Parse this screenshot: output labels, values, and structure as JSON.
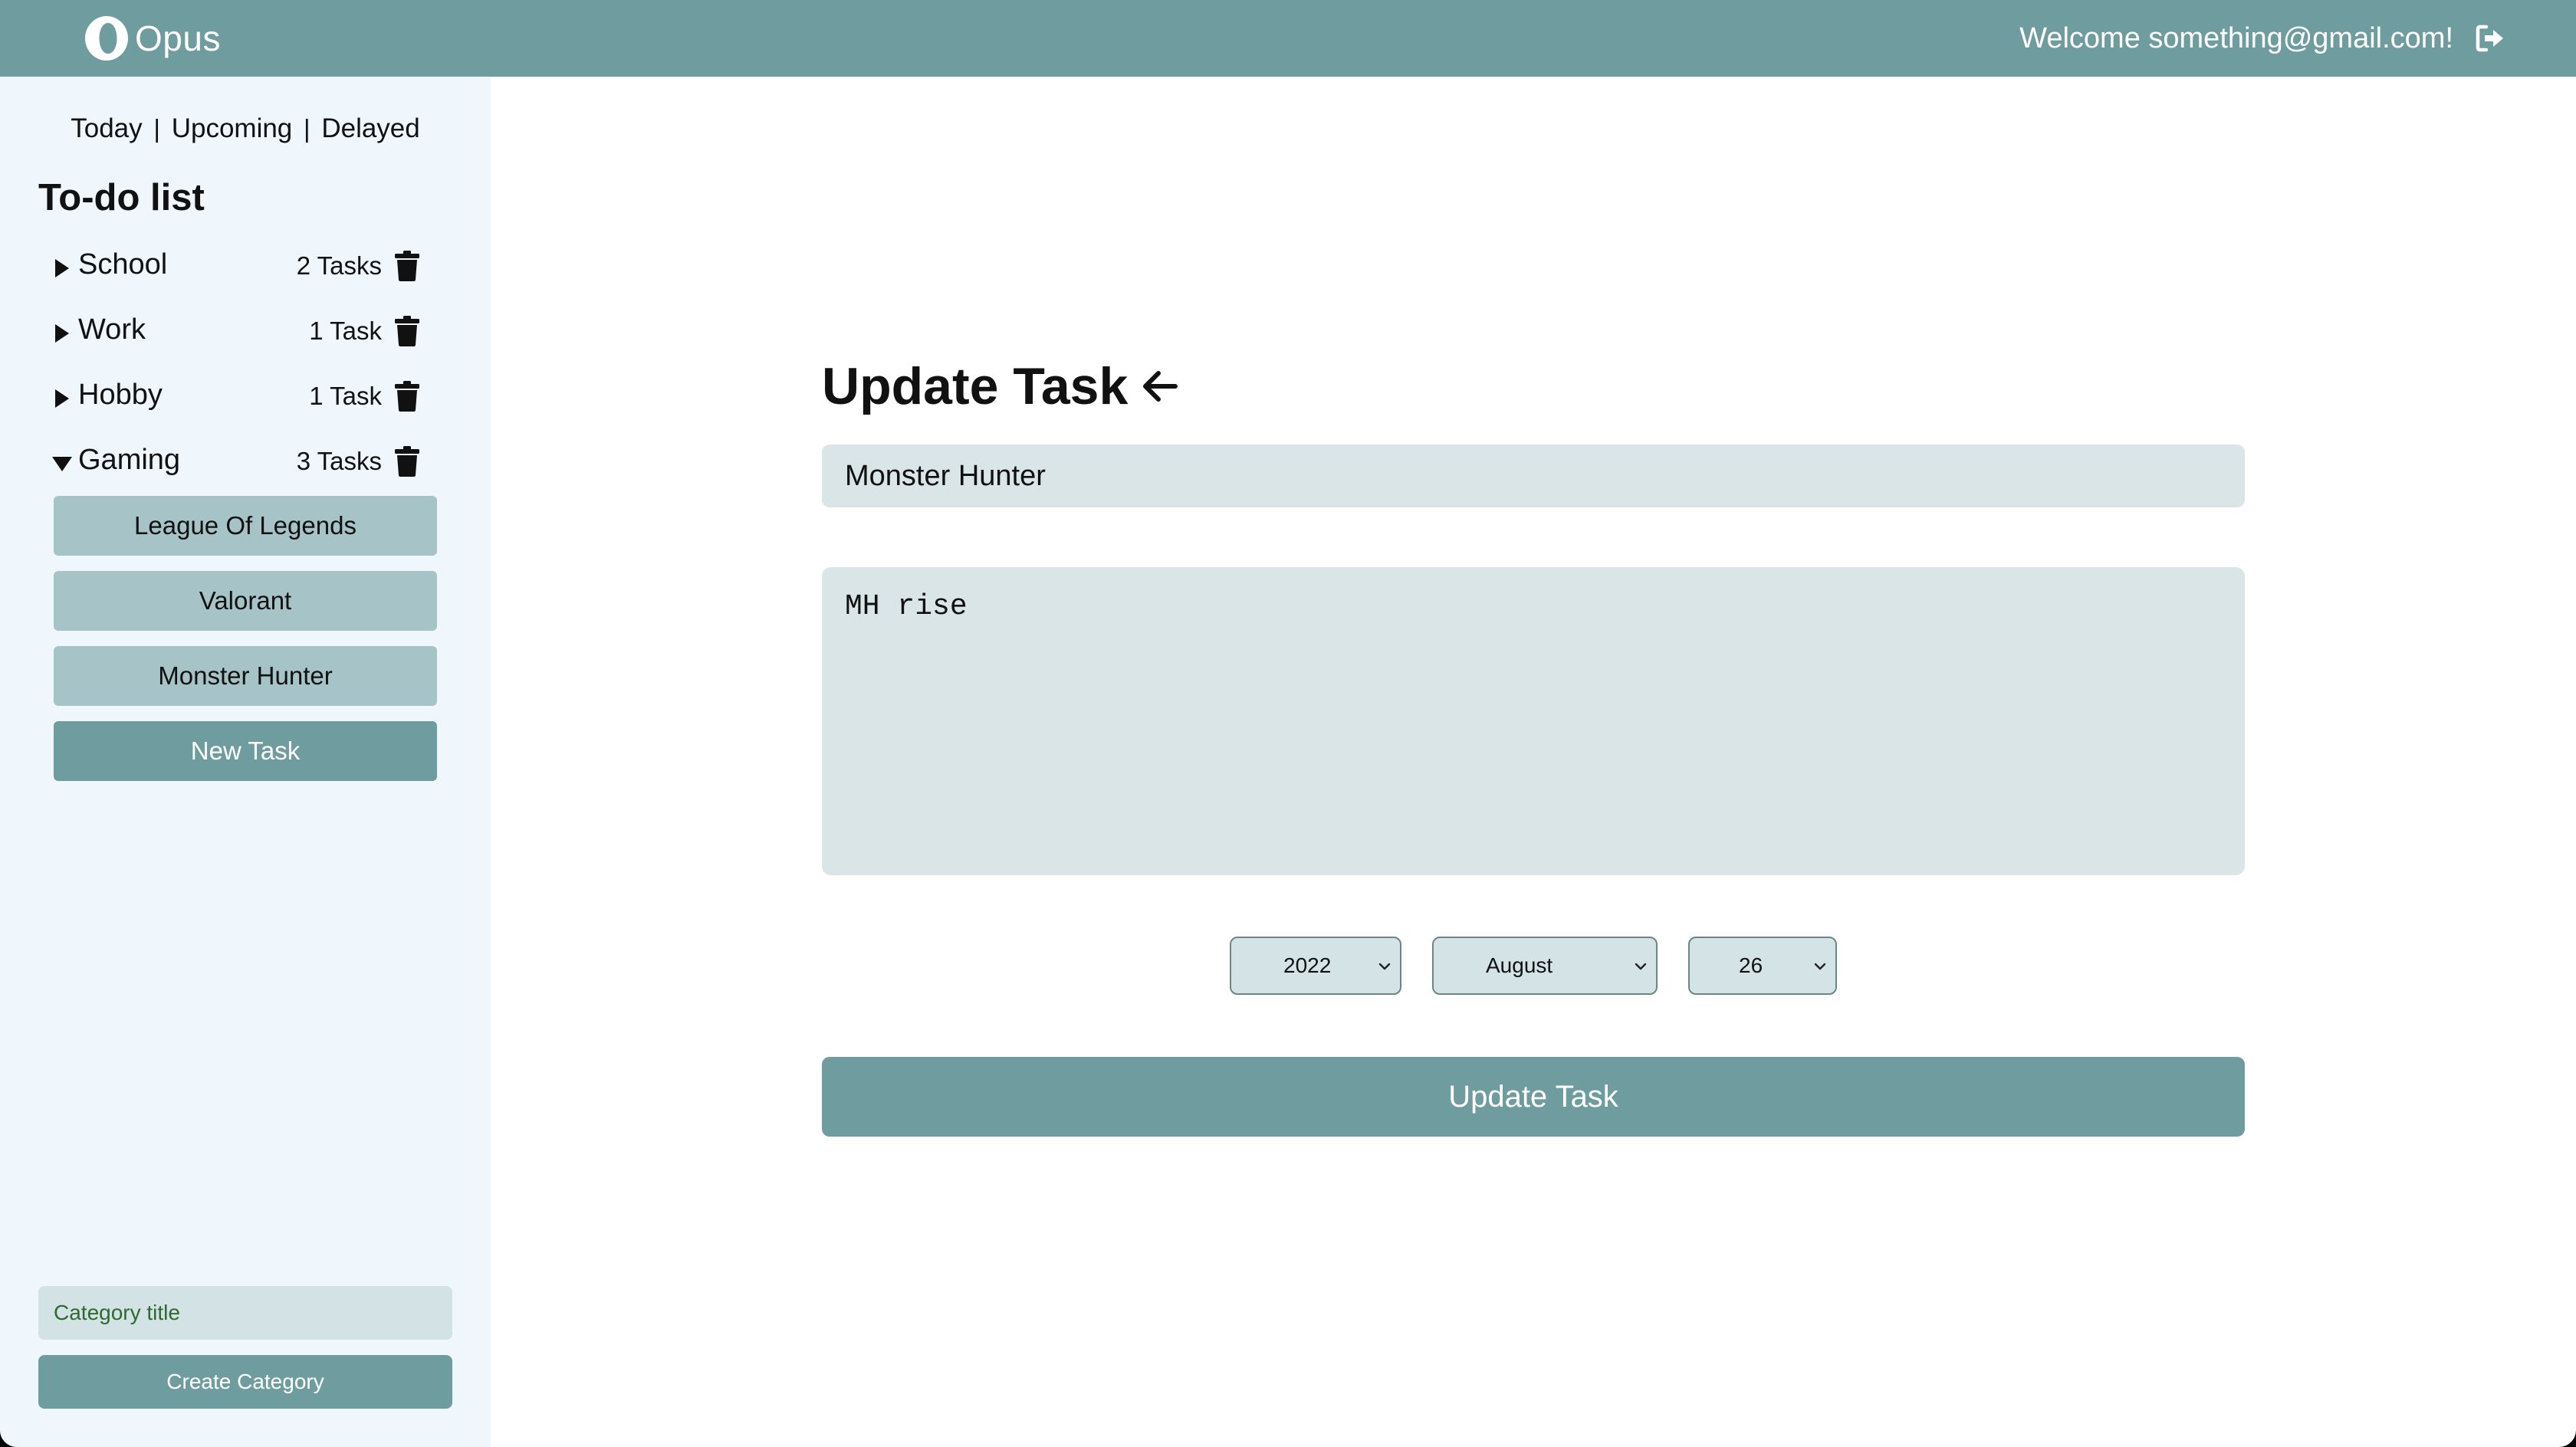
{
  "header": {
    "app_name": "Opus",
    "logo_icon": "opus-logo-icon",
    "welcome_text": "Welcome something@gmail.com!",
    "logout_icon": "logout-icon",
    "background": "#6f9c9e"
  },
  "sidebar": {
    "views": [
      "Today",
      "Upcoming",
      "Delayed"
    ],
    "separator": "|",
    "title": "To-do list",
    "categories": [
      {
        "name": "School",
        "count": "2 Tasks",
        "expanded": false
      },
      {
        "name": "Work",
        "count": "1 Task",
        "expanded": false
      },
      {
        "name": "Hobby",
        "count": "1 Task",
        "expanded": false
      },
      {
        "name": "Gaming",
        "count": "3 Tasks",
        "expanded": true
      }
    ],
    "tasks": [
      "League Of Legends",
      "Valorant",
      "Monster Hunter"
    ],
    "new_task_label": "New Task",
    "category_placeholder": "Category title",
    "create_category_label": "Create Category"
  },
  "form": {
    "heading": "Update Task",
    "back_icon": "arrow-left-icon",
    "title_value": "Monster Hunter",
    "description_value": "MH rise",
    "year": "2022",
    "month": "August",
    "day": "26",
    "submit_label": "Update Task"
  },
  "colors": {
    "accent": "#6f9c9e",
    "task_button": "#a6c4c7",
    "input_background": "#d9e5e7",
    "sidebar_background": "#eff7fd"
  }
}
